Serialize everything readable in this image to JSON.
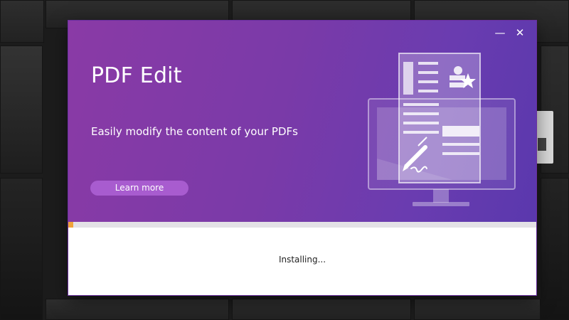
{
  "window": {
    "minimize_glyph": "—",
    "close_glyph": "✕"
  },
  "banner": {
    "title": "PDF Edit",
    "tagline": "Easily modify the content of your PDFs",
    "learn_more_label": "Learn more",
    "illustration": "pdf-edit-illustration"
  },
  "progress": {
    "fraction": 0.01,
    "color": "#f0a33a"
  },
  "status": {
    "text": "Installing..."
  },
  "colors": {
    "banner_start": "#8a3aa6",
    "banner_end": "#5a38ad",
    "button": "#a85ccf"
  }
}
